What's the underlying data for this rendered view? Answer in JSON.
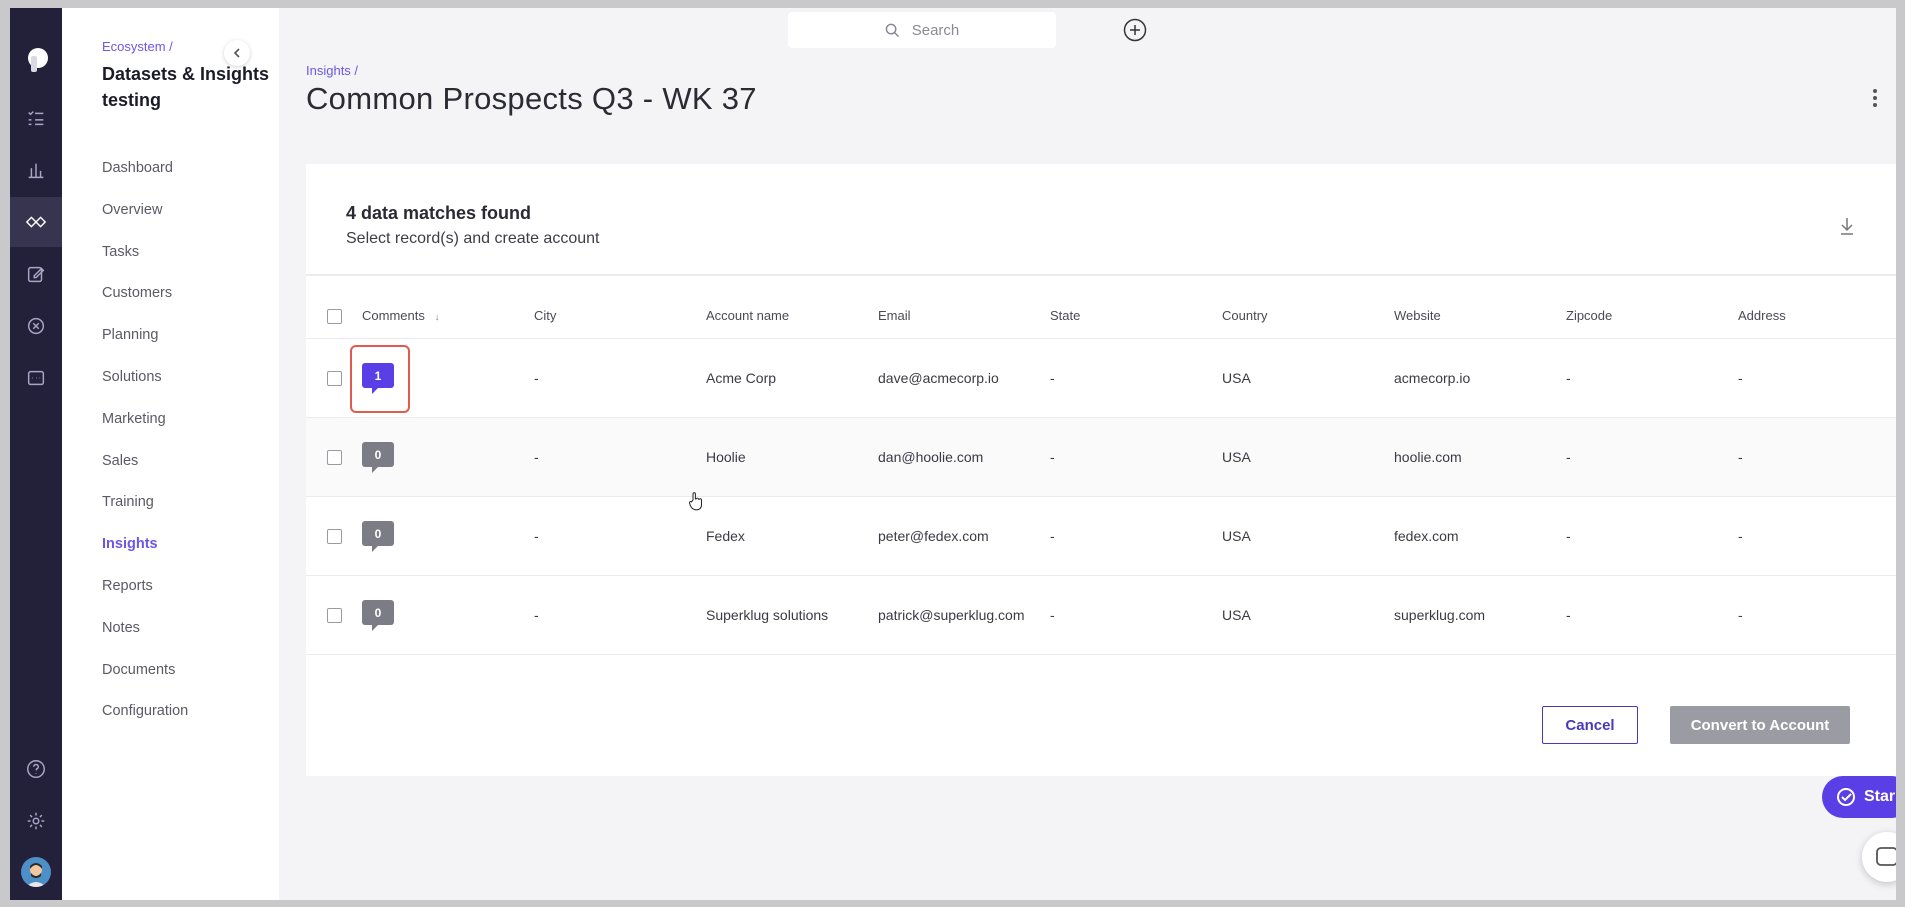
{
  "sidebar": {
    "breadcrumb": "Ecosystem /",
    "title": "Datasets & Insights testing",
    "items": [
      {
        "label": "Dashboard"
      },
      {
        "label": "Overview"
      },
      {
        "label": "Tasks"
      },
      {
        "label": "Customers"
      },
      {
        "label": "Planning"
      },
      {
        "label": "Solutions"
      },
      {
        "label": "Marketing"
      },
      {
        "label": "Sales"
      },
      {
        "label": "Training"
      },
      {
        "label": "Insights",
        "active": true
      },
      {
        "label": "Reports"
      },
      {
        "label": "Notes"
      },
      {
        "label": "Documents"
      },
      {
        "label": "Configuration"
      }
    ]
  },
  "rail": {
    "icons": [
      "logo-icon",
      "tasks-list-icon",
      "chart-icon",
      "ecosystem-icon",
      "edit-icon",
      "close-circle-icon",
      "dashboard-icon",
      "help-icon",
      "settings-icon",
      "avatar"
    ]
  },
  "topbar": {
    "search_placeholder": "Search"
  },
  "page": {
    "breadcrumb": "Insights /",
    "title": "Common Prospects Q3 - WK 37"
  },
  "card": {
    "heading": "4 data matches found",
    "subheading": "Select record(s) and create account"
  },
  "table": {
    "columns": [
      "Comments",
      "City",
      "Account name",
      "Email",
      "State",
      "Country",
      "Website",
      "Zipcode",
      "Address"
    ],
    "sort_indicator": "↓",
    "rows": [
      {
        "comments": "1",
        "city": "-",
        "account": "Acme Corp",
        "email": "dave@acmecorp.io",
        "state": "-",
        "country": "USA",
        "website": "acmecorp.io",
        "zipcode": "-",
        "address": "-"
      },
      {
        "comments": "0",
        "city": "-",
        "account": "Hoolie",
        "email": "dan@hoolie.com",
        "state": "-",
        "country": "USA",
        "website": "hoolie.com",
        "zipcode": "-",
        "address": "-"
      },
      {
        "comments": "0",
        "city": "-",
        "account": "Fedex",
        "email": "peter@fedex.com",
        "state": "-",
        "country": "USA",
        "website": "fedex.com",
        "zipcode": "-",
        "address": "-"
      },
      {
        "comments": "0",
        "city": "-",
        "account": "Superklug solutions",
        "email": "patrick@superklug.com",
        "state": "-",
        "country": "USA",
        "website": "superklug.com",
        "zipcode": "-",
        "address": "-"
      }
    ]
  },
  "actions": {
    "cancel": "Cancel",
    "convert": "Convert to Account"
  },
  "widgets": {
    "start_label": "Star"
  },
  "colors": {
    "accent": "#6b57e6",
    "rail_bg": "#23213a",
    "highlight": "#e05a4f"
  }
}
